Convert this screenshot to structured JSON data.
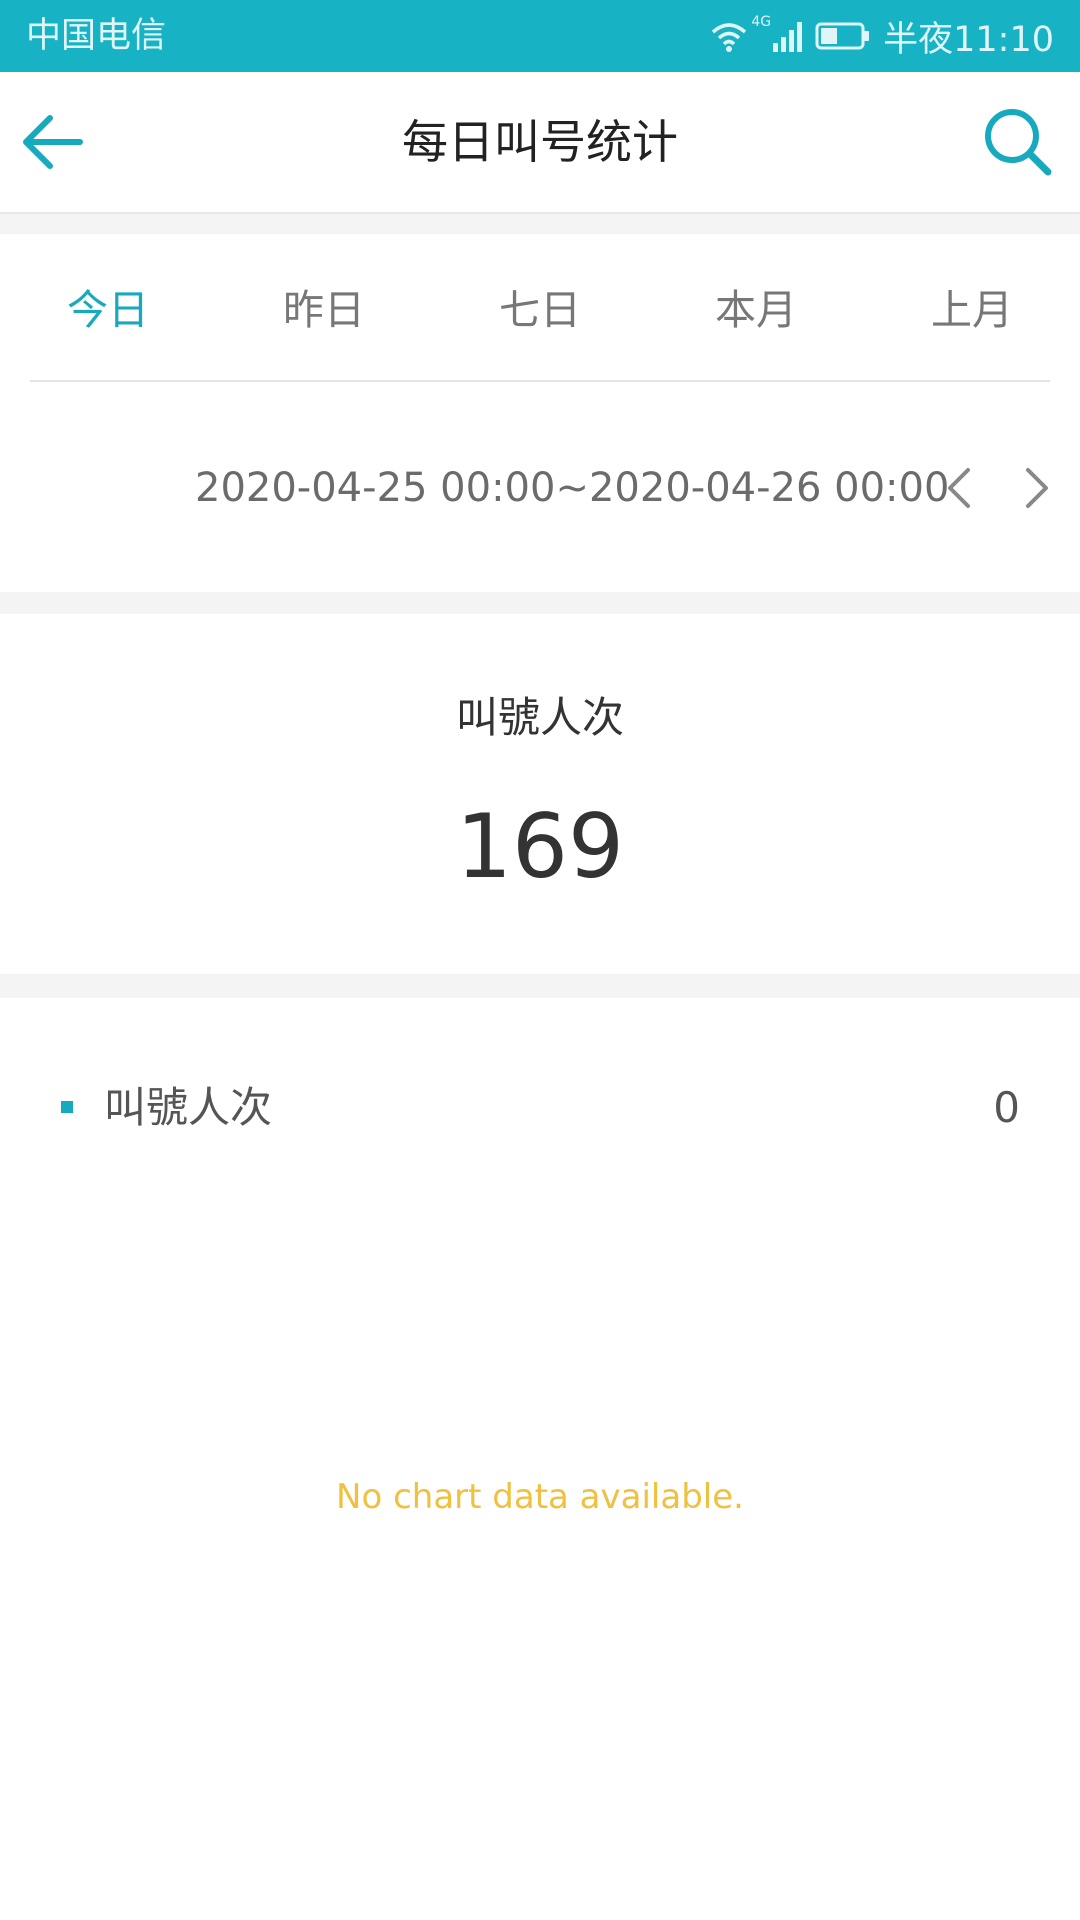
{
  "status_bar": {
    "carrier": "中国电信",
    "network": "4G",
    "time": "半夜11:10",
    "battery_level": 0.4
  },
  "header": {
    "title": "每日叫号统计",
    "back_icon": "back-arrow-icon",
    "search_icon": "search-icon"
  },
  "tabs": [
    {
      "label": "今日",
      "active": true
    },
    {
      "label": "昨日",
      "active": false
    },
    {
      "label": "七日",
      "active": false
    },
    {
      "label": "本月",
      "active": false
    },
    {
      "label": "上月",
      "active": false
    }
  ],
  "date_range": {
    "text": "2020-04-25 00:00~2020-04-26 00:00",
    "prev_icon": "chevron-left-icon",
    "next_icon": "chevron-right-icon"
  },
  "summary": {
    "label": "叫號人次",
    "value": "169"
  },
  "legend": {
    "label": "叫號人次",
    "value": "0"
  },
  "chart": {
    "empty_message": "No chart data available."
  },
  "colors": {
    "accent": "#17b3c5",
    "active_tab": "#17a9bd",
    "empty_message": "#f0c040"
  }
}
